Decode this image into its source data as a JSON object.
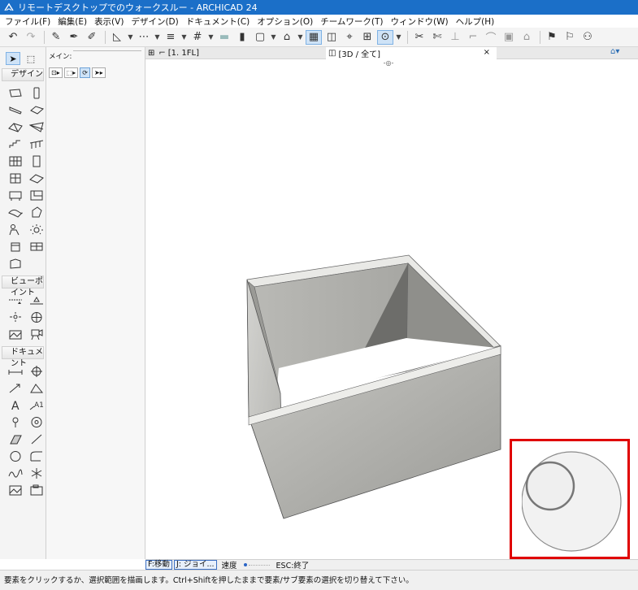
{
  "window": {
    "title": "リモートデスクトップでのウォークスルー - ARCHICAD 24"
  },
  "menu": {
    "items": [
      {
        "label": "ファイル(F)"
      },
      {
        "label": "編集(E)"
      },
      {
        "label": "表示(V)"
      },
      {
        "label": "デザイン(D)"
      },
      {
        "label": "ドキュメント(C)"
      },
      {
        "label": "オプション(O)"
      },
      {
        "label": "チームワーク(T)"
      },
      {
        "label": "ウィンドウ(W)"
      },
      {
        "label": "ヘルプ(H)"
      }
    ]
  },
  "toolbox": {
    "groups": [
      {
        "label": "デザイン"
      },
      {
        "label": "ビューポイント"
      },
      {
        "label": "ドキュメント"
      }
    ]
  },
  "infobox": {
    "main_label": "メイン:"
  },
  "tabs": {
    "floor_plan": "[1. 1FL]",
    "view_3d": "[3D / 全て]",
    "close_glyph": "×"
  },
  "statusbar": {
    "move_chip": "F:移動",
    "jump_chip": "J: ジョイ...",
    "speed_label": "速度",
    "esc_label": "ESC:終了"
  },
  "hint": {
    "text": "要素をクリックするか、選択範囲を描画します。Ctrl+Shiftを押したままで要素/サブ要素の選択を切り替えて下さい。"
  },
  "colors": {
    "titlebar": "#1b6fc8",
    "highlight": "#e00000",
    "accent": "#2a6db5"
  }
}
